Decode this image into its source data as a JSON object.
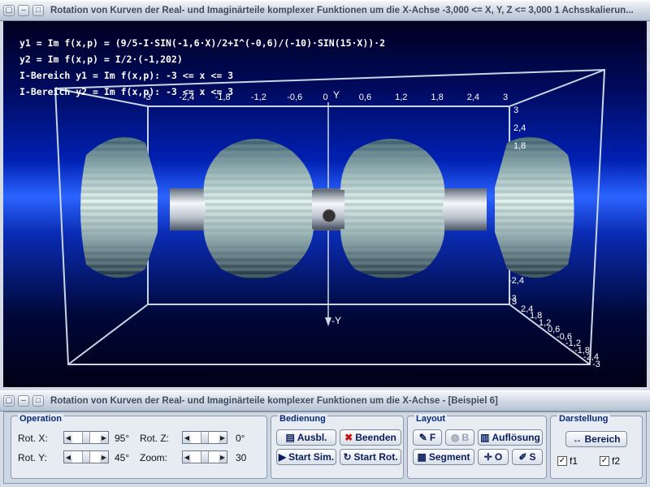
{
  "window_top": {
    "title": "Rotation von Kurven der Real- und Imaginärteile komplexer Funktionen um die X-Achse   -3,000 <= X, Y, Z <= 3,000    1 Achsskalierun..."
  },
  "scene": {
    "lines": [
      "y1 = Im f(x,p) = (9/5-I·SIN(-1,6·X)/2+I^(-0,6)/(-10)·SIN(15·X))·2",
      "y2 = Im f(x,p) = I/2·(-1,202)",
      "I-Bereich y1 = Im f(x,p): -3 <= x <= 3",
      "I-Bereich y2 = Im f(x,p): -3 <= x <= 3"
    ],
    "axis_y_label": "Y",
    "axis_neg_y_label": "-Y",
    "x_ticks": [
      "-3",
      "-2,4",
      "-1,8",
      "-1,2",
      "-0,6",
      "0",
      "0,6",
      "1,2",
      "1,8",
      "2,4",
      "3"
    ],
    "y_ticks_top": [
      "3",
      "2,4",
      "1,8"
    ],
    "y_ticks_bottom": [
      "-2,4",
      "-3"
    ],
    "z_ticks": [
      "3",
      "2,4",
      "1,8",
      "1,2",
      "0,6",
      "-0,6",
      "-1,2",
      "-1,8",
      "-2,4",
      "-3"
    ]
  },
  "window_bottom": {
    "title": "Rotation von Kurven der Real- und Imaginärteile komplexer Funktionen um die X-Achse - [Beispiel 6]"
  },
  "operation": {
    "title": "Operation",
    "rot_x_label": "Rot. X:",
    "rot_x_value": "95°",
    "rot_y_label": "Rot. Y:",
    "rot_y_value": "45°",
    "rot_z_label": "Rot. Z:",
    "rot_z_value": "0°",
    "zoom_label": "Zoom:",
    "zoom_value": "30"
  },
  "bedienung": {
    "title": "Bedienung",
    "ausbl": "Ausbl.",
    "beenden": "Beenden",
    "start_sim": "Start Sim.",
    "start_rot": "Start Rot."
  },
  "layout": {
    "title": "Layout",
    "f_btn": "F",
    "b_btn": "B",
    "aufloesung": "Auflösung",
    "segment": "Segment",
    "o_btn": "O",
    "s_btn": "S"
  },
  "darstellung": {
    "title": "Darstellung",
    "bereich": "Bereich",
    "f1": "f1",
    "f2": "f2"
  }
}
